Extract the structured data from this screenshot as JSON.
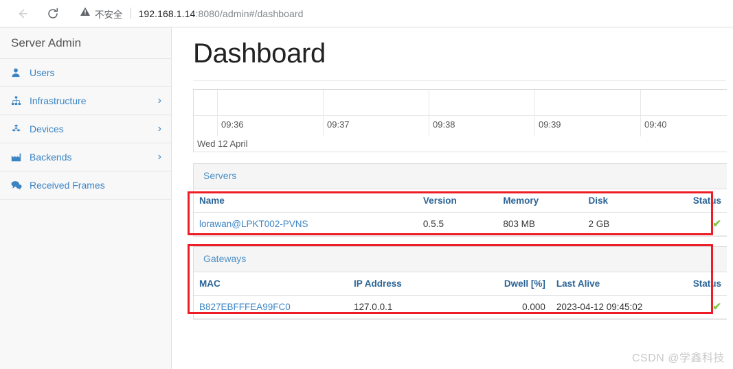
{
  "browser": {
    "back_icon": "back-arrow-icon",
    "reload_icon": "reload-icon",
    "security_icon": "warning-triangle-icon",
    "security_label": "不安全",
    "url_host": "192.168.1.14",
    "url_rest": ":8080/admin#/dashboard"
  },
  "sidebar": {
    "brand": "Server Admin",
    "items": [
      {
        "label": "Users",
        "icon": "user-icon",
        "has_chevron": false
      },
      {
        "label": "Infrastructure",
        "icon": "sitemap-icon",
        "has_chevron": true
      },
      {
        "label": "Devices",
        "icon": "cubes-icon",
        "has_chevron": true
      },
      {
        "label": "Backends",
        "icon": "industry-icon",
        "has_chevron": true
      },
      {
        "label": "Received Frames",
        "icon": "comments-icon",
        "has_chevron": false
      }
    ],
    "chevron_glyph": "›"
  },
  "main": {
    "page_title": "Dashboard"
  },
  "chart_data": {
    "type": "line",
    "title": "",
    "xlabel": "",
    "ylabel": "",
    "x": [
      "09:36",
      "09:37",
      "09:38",
      "09:39",
      "09:40"
    ],
    "date_label": "Wed 12 April",
    "series": [
      {
        "name": "",
        "values": [
          0,
          0,
          0,
          0,
          0
        ]
      }
    ],
    "grid": true,
    "legend": "none"
  },
  "servers_panel": {
    "title": "Servers",
    "columns": [
      "Name",
      "Version",
      "Memory",
      "Disk",
      "Status"
    ],
    "rows": [
      {
        "name": "lorawan@LPKT002-PVNS",
        "version": "0.5.5",
        "memory": "803 MB",
        "disk": "2 GB",
        "status": "✔"
      }
    ]
  },
  "gateways_panel": {
    "title": "Gateways",
    "columns": [
      "MAC",
      "IP Address",
      "Dwell [%]",
      "Last Alive",
      "Status"
    ],
    "rows": [
      {
        "mac": "B827EBFFFEA99FC0",
        "ip": "127.0.0.1",
        "dwell": "0.000",
        "last_alive": "2023-04-12 09:45:02",
        "status": "✔"
      }
    ]
  },
  "watermark": {
    "text": "CSDN @学鑫科技"
  },
  "colors": {
    "link": "#3b84c4",
    "header_link": "#2a6496",
    "annotation": "#ee1c25",
    "status_ok": "#7ac943"
  }
}
